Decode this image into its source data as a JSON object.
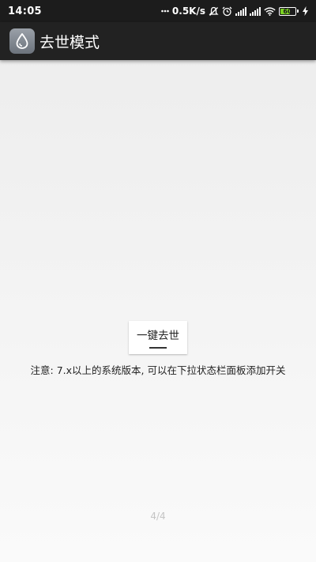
{
  "status_bar": {
    "time": "14:05",
    "net_speed": "0.5K/s",
    "battery_level": "60",
    "icons": [
      "mute-icon",
      "alarm-icon",
      "signal-icon",
      "signal-icon",
      "wifi-icon",
      "battery-icon",
      "charging-icon"
    ]
  },
  "app_bar": {
    "title": "去世模式",
    "icon": "water-drop-icon"
  },
  "main": {
    "button_label": "一键去世",
    "notice": "注意: 7.x以上的系统版本, 可以在下拉状态栏面板添加开关"
  },
  "page_indicator": "4/4",
  "colors": {
    "status_bar_bg": "#1c1c1c",
    "app_bar_bg": "#222222",
    "battery_fill": "#7bd321"
  }
}
